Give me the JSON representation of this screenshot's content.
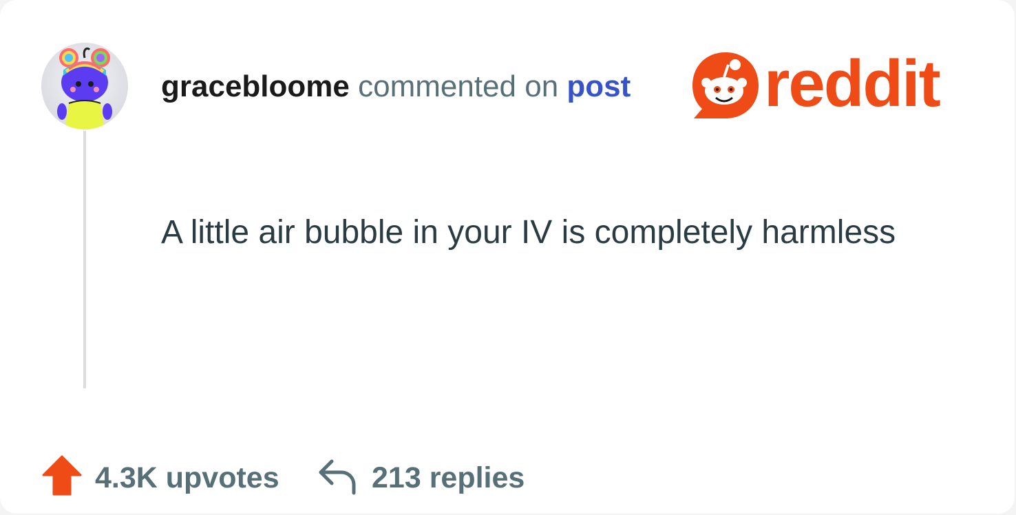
{
  "comment": {
    "username": "gracebloome",
    "action_text": "commented on",
    "post_link": "post",
    "body": "A little air bubble in your IV is completely harmless"
  },
  "brand": {
    "wordmark": "reddit",
    "color": "#ee4b16"
  },
  "stats": {
    "upvotes": "4.3K upvotes",
    "replies": "213 replies"
  },
  "colors": {
    "username": "#1a1a1b",
    "secondary_text": "#576f76",
    "link": "#3653c8",
    "body_text": "#2a3c42",
    "upvote_accent": "#ee4b16"
  },
  "icons": {
    "upvote": "upvote-arrow-icon",
    "reply": "reply-arrow-icon",
    "logo": "reddit-snoo-icon",
    "avatar": "avatar-snoo"
  }
}
